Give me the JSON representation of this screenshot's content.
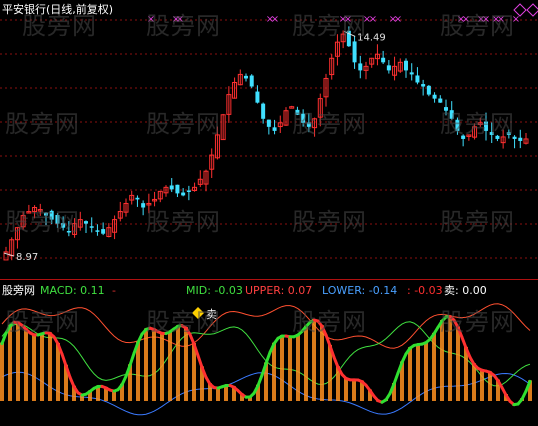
{
  "header": {
    "title": "平安银行(日线,前复权)"
  },
  "indicator": {
    "name": "股旁网",
    "macd": "MACD: 0.11",
    "macd_extra": "-",
    "mid": "MID: -0.03",
    "upper": "UPPER: 0.07",
    "lower": "LOWER: -0.14",
    "red": ": -0.03",
    "sell": "卖: 0.00"
  },
  "watermark": "股旁网",
  "colors": {
    "up": "#ff3030",
    "down": "#40e0ff",
    "grid": "#8a1010",
    "signal": "#e040e0",
    "mid_line": "#40e040",
    "upper_line": "#ff5030",
    "lower_line": "#3a7aff",
    "macd_thick_green": "#30e030",
    "macd_thick_red": "#ff3030",
    "histogram": "#ff9020",
    "marker": "#ffd000"
  },
  "chart_data": [
    {
      "type": "candlestick",
      "annotations": [
        {
          "label": "14.49",
          "kind": "high"
        },
        {
          "label": "8.97",
          "kind": "low"
        }
      ],
      "high_value": 14.49,
      "low_value": 8.97,
      "close_series": [
        9.0,
        9.3,
        9.6,
        9.9,
        10.0,
        10.1,
        10.05,
        9.9,
        9.8,
        9.7,
        9.6,
        9.5,
        9.7,
        9.8,
        9.7,
        9.6,
        9.5,
        9.45,
        9.6,
        9.8,
        10.0,
        10.2,
        10.4,
        10.3,
        10.1,
        10.2,
        10.3,
        10.5,
        10.6,
        10.55,
        10.45,
        10.4,
        10.5,
        10.6,
        10.8,
        11.0,
        11.4,
        11.9,
        12.4,
        12.9,
        13.2,
        13.4,
        13.3,
        13.1,
        12.7,
        12.3,
        12.1,
        12.0,
        12.2,
        12.5,
        12.6,
        12.4,
        12.2,
        12.1,
        12.3,
        12.8,
        13.3,
        13.8,
        14.2,
        14.4,
        14.1,
        13.7,
        13.5,
        13.6,
        13.8,
        13.9,
        13.7,
        13.5,
        13.6,
        13.7,
        13.5,
        13.4,
        13.2,
        13.1,
        12.9,
        12.8,
        12.7,
        12.5,
        12.3,
        12.0,
        11.8,
        11.9,
        12.1,
        12.2,
        12.0,
        11.9,
        11.8,
        11.85,
        11.9,
        11.8,
        11.75,
        11.8
      ],
      "signal_markers": "pink x at top",
      "grid": true
    },
    {
      "type": "line",
      "series": [
        {
          "name": "MID",
          "color_key": "mid_line"
        },
        {
          "name": "UPPER",
          "color_key": "upper_line"
        },
        {
          "name": "LOWER",
          "color_key": "lower_line"
        },
        {
          "name": "MACD",
          "color_key": "macd_thick_green"
        }
      ],
      "legend_text": [
        "MACD: 0.11",
        "MID: -0.03",
        "UPPER: 0.07",
        "LOWER: -0.14",
        ": -0.03",
        "卖: 0.00"
      ],
      "sell_marker_label": "卖"
    }
  ]
}
